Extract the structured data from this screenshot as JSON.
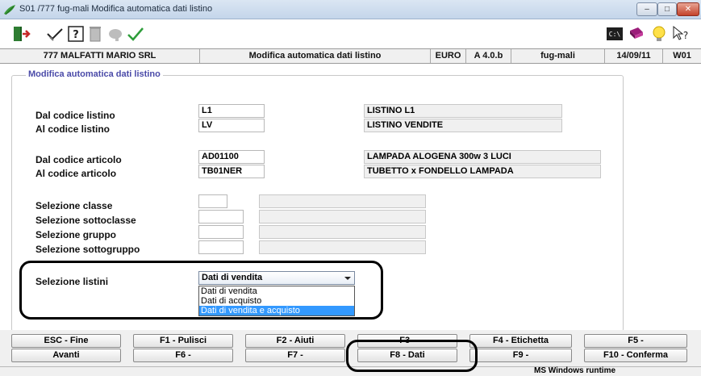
{
  "window": {
    "title": "S01 /777 fug-mali Modifica automatica dati listino",
    "controls": [
      "minimize",
      "maximize",
      "close"
    ]
  },
  "toolbar": {
    "icons": [
      "exit-icon",
      "check-icon",
      "help-icon",
      "trash-icon",
      "thumb-down-icon",
      "confirm-icon",
      "terminal-icon",
      "book-icon",
      "lightbulb-icon",
      "context-help-icon"
    ],
    "terminal_label": "C:\\"
  },
  "header": {
    "company": "777 MALFATTI MARIO SRL",
    "program": "Modifica automatica dati listino",
    "currency": "EURO",
    "version": "A 4.0.b",
    "user": "fug-mali",
    "date": "14/09/11",
    "workstation": "W01"
  },
  "form": {
    "group_title": "Modifica automatica dati listino",
    "dal_listino": {
      "label": "Dal codice listino",
      "value": "L1",
      "desc": "LISTINO L1"
    },
    "al_listino": {
      "label": "Al  codice listino",
      "value": "LV",
      "desc": "LISTINO VENDITE"
    },
    "dal_articolo": {
      "label": "Dal codice articolo",
      "value": "AD01100",
      "desc": "LAMPADA ALOGENA 300w 3 LUCI"
    },
    "al_articolo": {
      "label": "Al  codice articolo",
      "value": "TB01NER",
      "desc": "TUBETTO x FONDELLO LAMPADA"
    },
    "classe": {
      "label": "Selezione classe",
      "value": "",
      "desc": ""
    },
    "sottoclasse": {
      "label": "Selezione sottoclasse",
      "value": ""
    },
    "gruppo": {
      "label": "Selezione gruppo",
      "value": ""
    },
    "sottogruppo": {
      "label": "Selezione sottogruppo",
      "value": ""
    },
    "listini": {
      "label": "Selezione listini",
      "selected": "Dati di vendita",
      "options": [
        "Dati di vendita",
        "Dati di acquisto",
        "Dati di vendita e acquisto"
      ],
      "highlighted_index": 2
    }
  },
  "buttons": {
    "row1": [
      "ESC - Fine",
      "F1 - Pulisci",
      "F2 - Aiuti",
      "F3 -",
      "F4 - Etichetta",
      "F5 -"
    ],
    "row2": [
      "Avanti",
      "F6 -",
      "F7 -",
      "F8 - Dati",
      "F9 -",
      "F10 - Conferma"
    ]
  },
  "status": {
    "runtime": "MS Windows runtime"
  },
  "colors": {
    "title_bar": "#c4d5ea",
    "group_title": "#4a4aa8",
    "highlight": "#3399ff",
    "close_button": "#c4432c"
  }
}
